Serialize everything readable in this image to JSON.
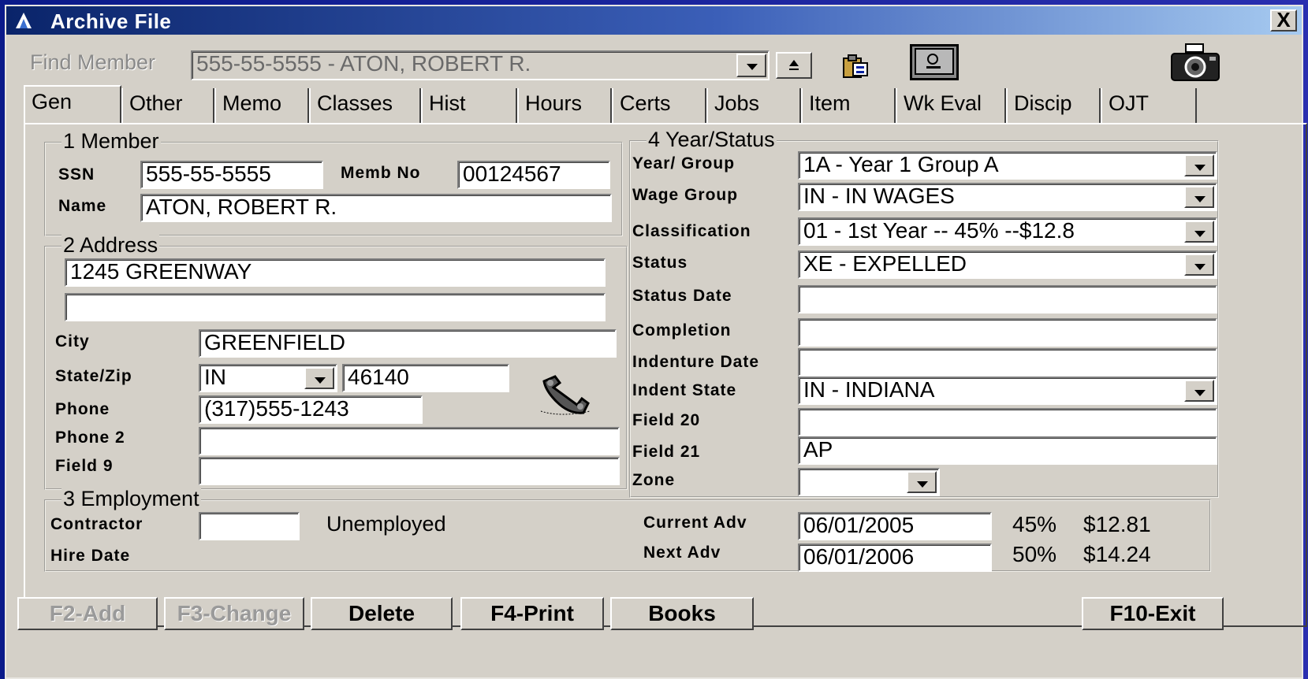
{
  "window": {
    "title": "Archive File",
    "close_label": "X"
  },
  "find_member": {
    "label": "Find Member",
    "value": "555-55-5555 - ATON, ROBERT R."
  },
  "tabs": [
    "Gen",
    "Other",
    "Memo",
    "Classes",
    "Hist",
    "Hours",
    "Certs",
    "Jobs",
    "Item",
    "Wk Eval",
    "Discip",
    "OJT"
  ],
  "member": {
    "group_title": "1 Member",
    "ssn_label": "SSN",
    "ssn": "555-55-5555",
    "memb_no_label": "Memb No",
    "memb_no": "00124567",
    "name_label": "Name",
    "name": "ATON, ROBERT R."
  },
  "address": {
    "group_title": "2 Address",
    "line1": "1245 GREENWAY",
    "line2": "",
    "city_label": "City",
    "city": "GREENFIELD",
    "state_zip_label": "State/Zip",
    "state": "IN",
    "zip": "46140",
    "phone_label": "Phone",
    "phone": "(317)555-1243",
    "phone2_label": "Phone 2",
    "phone2": "",
    "field9_label": "Field 9",
    "field9": ""
  },
  "year_status": {
    "group_title": "4 Year/Status",
    "year_group_label": "Year/ Group",
    "year_group": "1A   - Year 1 Group A",
    "wage_group_label": "Wage Group",
    "wage_group": "IN   - IN WAGES",
    "classification_label": "Classification",
    "classification": "01   - 1st Year -- 45% --$12.8",
    "status_label": "Status",
    "status": "XE   - EXPELLED",
    "status_date_label": "Status Date",
    "status_date": "",
    "completion_label": "Completion",
    "completion": "",
    "indenture_date_label": "Indenture Date",
    "indenture_date": "",
    "indent_state_label": "Indent State",
    "indent_state": "IN   - INDIANA",
    "field20_label": "Field 20",
    "field20": "",
    "field21_label": "Field 21",
    "field21": "AP",
    "zone_label": "Zone",
    "zone": ""
  },
  "employment": {
    "group_title": "3 Employment",
    "contractor_label": "Contractor",
    "contractor": "",
    "employment_status": "Unemployed",
    "hire_date_label": "Hire Date",
    "current_adv_label": "Current Adv",
    "current_adv": "06/01/2005",
    "current_pct": "45%",
    "current_rate": "$12.81",
    "next_adv_label": "Next Adv",
    "next_adv": "06/01/2006",
    "next_pct": "50%",
    "next_rate": "$14.24"
  },
  "buttons": {
    "add": "F2-Add",
    "change": "F3-Change",
    "delete": "Delete",
    "print": "F4-Print",
    "books": "Books",
    "exit": "F10-Exit"
  },
  "icons": [
    "app-icon",
    "close-icon",
    "dropdown-arrow-icon",
    "jump-up-icon",
    "clipboard-icon",
    "safe-icon",
    "camera-icon",
    "phone-handset-icon"
  ]
}
